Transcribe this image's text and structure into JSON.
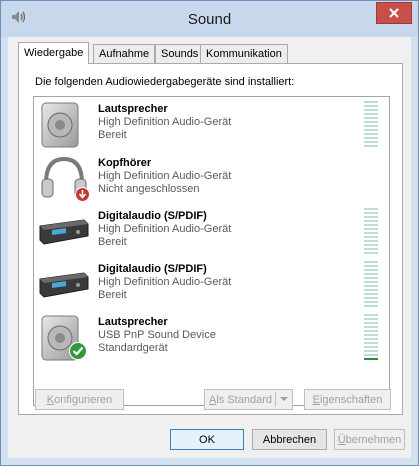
{
  "window": {
    "title": "Sound"
  },
  "tabs": [
    {
      "label": "Wiedergabe",
      "active": true
    },
    {
      "label": "Aufnahme",
      "active": false
    },
    {
      "label": "Sounds",
      "active": false
    },
    {
      "label": "Kommunikation",
      "active": false
    }
  ],
  "panel": {
    "label": "Die folgenden Audiowiedergabegeräte sind installiert:"
  },
  "devices": [
    {
      "name": "Lautsprecher",
      "desc": "High Definition Audio-Gerät",
      "status": "Bereit",
      "icon": "speaker-icon",
      "badge": "",
      "meter_level": 0
    },
    {
      "name": "Kopfhörer",
      "desc": "High Definition Audio-Gerät",
      "status": "Nicht angeschlossen",
      "icon": "headphones-icon",
      "badge": "unplugged-badge-icon",
      "meter_level": null
    },
    {
      "name": "Digitalaudio (S/PDIF)",
      "desc": "High Definition Audio-Gerät",
      "status": "Bereit",
      "icon": "digital-audio-icon",
      "badge": "",
      "meter_level": 0
    },
    {
      "name": "Digitalaudio (S/PDIF)",
      "desc": "High Definition Audio-Gerät",
      "status": "Bereit",
      "icon": "digital-audio-icon",
      "badge": "",
      "meter_level": 0
    },
    {
      "name": "Lautsprecher",
      "desc": "USB PnP Sound Device",
      "status": "Standardgerät",
      "icon": "speaker-icon",
      "badge": "default-check-badge-icon",
      "meter_level": 0.08
    }
  ],
  "buttons": {
    "configure": {
      "prefix": "",
      "u": "K",
      "rest": "onfigurieren"
    },
    "set_default": {
      "prefix": "",
      "u": "A",
      "rest": "ls Standard"
    },
    "properties": {
      "prefix": "",
      "u": "E",
      "rest": "igenschaften"
    },
    "ok": "OK",
    "cancel": "Abbrechen",
    "apply": {
      "prefix": "",
      "u": "Ü",
      "rest": "bernehmen"
    }
  },
  "colors": {
    "meter_lit": "#2e8b3c",
    "meter_unlit": "#b9dfd6",
    "close_button": "#c7504c"
  }
}
